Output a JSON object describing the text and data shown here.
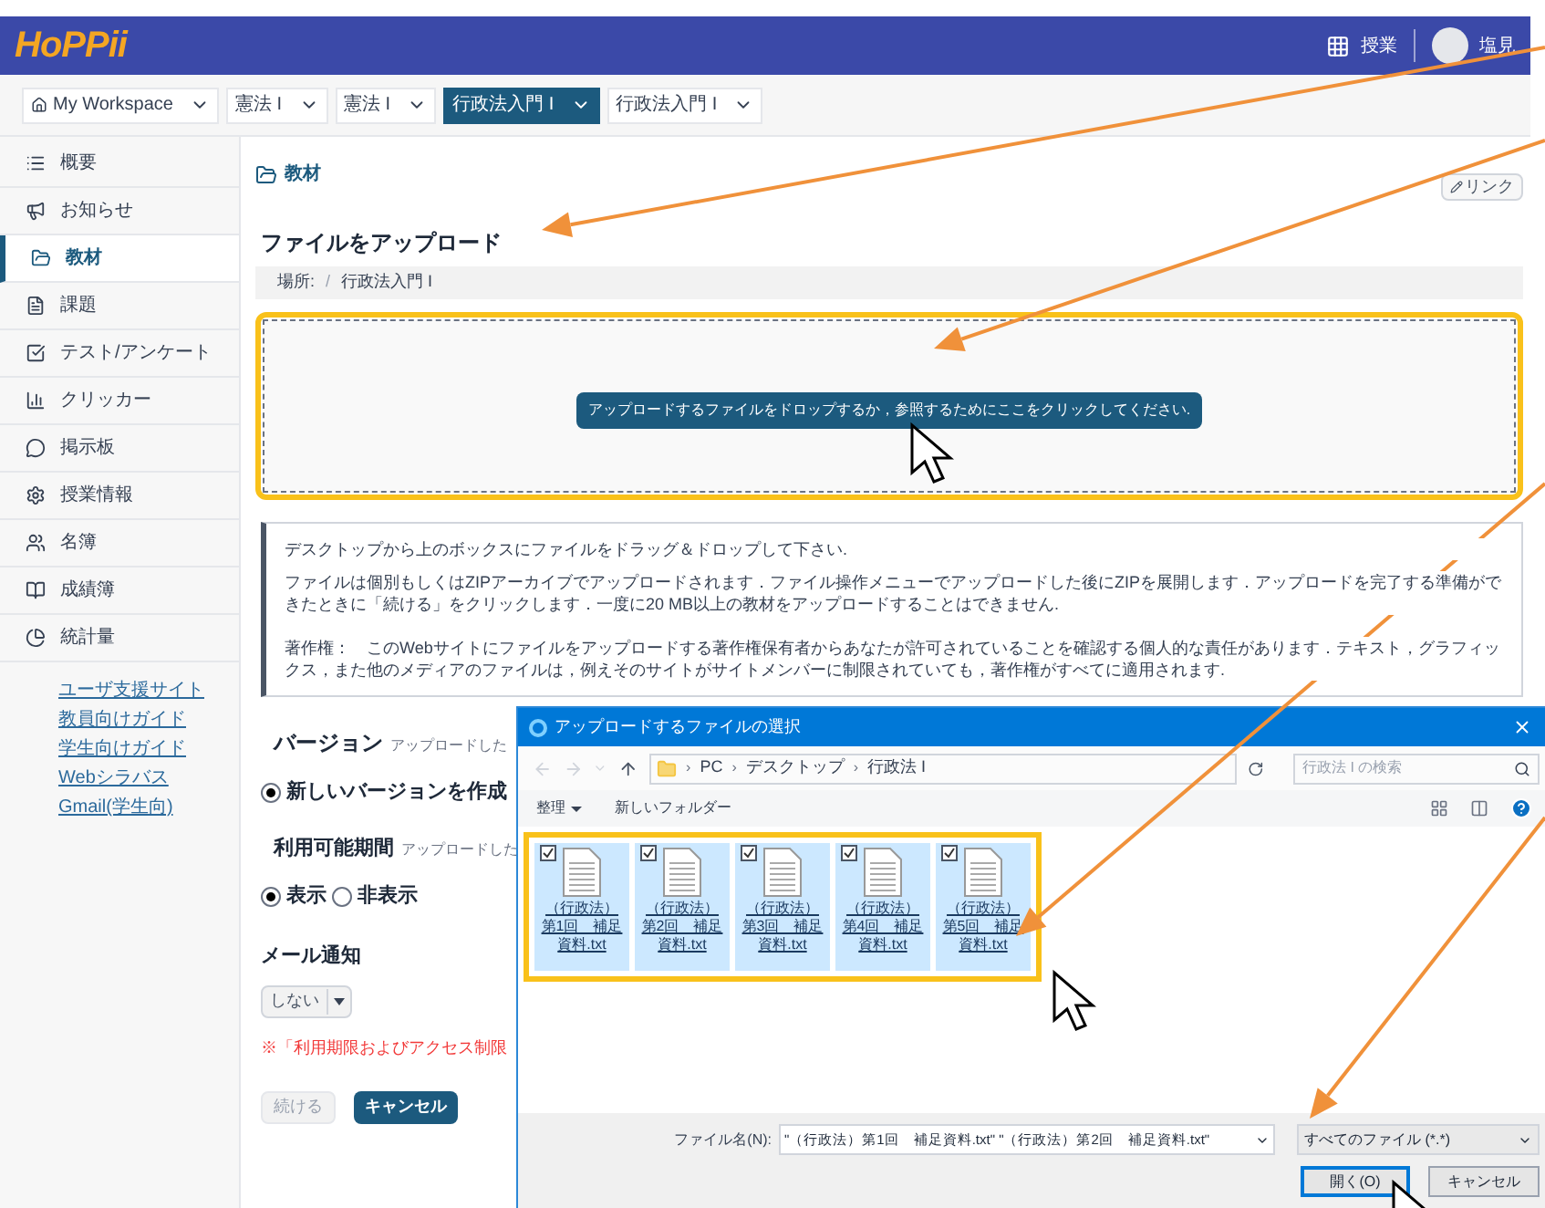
{
  "header": {
    "logo": "HoPPii",
    "apps_label": "授業",
    "user_name": "塩見"
  },
  "tabs": [
    {
      "label": "My Workspace",
      "selected": false
    },
    {
      "label": "憲法 I",
      "selected": false
    },
    {
      "label": "憲法 I",
      "selected": false
    },
    {
      "label": "行政法入門 I",
      "selected": true
    },
    {
      "label": "行政法入門 I",
      "selected": false
    }
  ],
  "sidebar": {
    "items": [
      {
        "label": "概要",
        "selected": false
      },
      {
        "label": "お知らせ",
        "selected": false
      },
      {
        "label": "教材",
        "selected": true
      },
      {
        "label": "課題",
        "selected": false
      },
      {
        "label": "テスト/アンケート",
        "selected": false
      },
      {
        "label": "クリッカー",
        "selected": false
      },
      {
        "label": "掲示板",
        "selected": false
      },
      {
        "label": "授業情報",
        "selected": false
      },
      {
        "label": "名簿",
        "selected": false
      },
      {
        "label": "成績簿",
        "selected": false
      },
      {
        "label": "統計量",
        "selected": false
      }
    ],
    "links": [
      "ユーザ支援サイト",
      "教員向けガイド",
      "学生向けガイド",
      "Webシラバス",
      "Gmail(学生向)"
    ]
  },
  "main": {
    "section_title": "教材",
    "link_button": "リンク",
    "heading": "ファイルをアップロード",
    "breadcrumb": {
      "label": "場所:",
      "separator": "/",
      "path": "行政法入門 I"
    },
    "drop_button": "アップロードするファイルをドロップするか，参照するためにここをクリックしてください.",
    "info": [
      "デスクトップから上のボックスにファイルをドラッグ＆ドロップして下さい.",
      "ファイルは個別もしくはZIPアーカイブでアップロードされます．ファイル操作メニューでアップロードした後にZIPを展開します．アップロードを完了する準備ができたときに「続ける」をクリックします．一度に20 MB以上の教材をアップロードすることはできません.",
      "著作権：　このWebサイトにファイルをアップロードする著作権保有者からあなたが許可されていることを確認する個人的な責任があります．テキスト，グラフィックス，また他のメディアのファイルは，例えそのサイトがサイトメンバーに制限されていても，著作権がすべてに適用されます."
    ],
    "version": {
      "label": "バージョン",
      "description": "アップロードした",
      "options": [
        {
          "label": "新しいバージョンを作成",
          "selected": true
        }
      ]
    },
    "availability": {
      "label": "利用可能期間",
      "description": "アップロードした",
      "options": [
        {
          "label": "表示",
          "selected": true
        },
        {
          "label": "非表示",
          "selected": false
        }
      ]
    },
    "mail": {
      "label": "メール通知",
      "value": "しない"
    },
    "note": "※「利用期限およびアクセス制限",
    "buttons": [
      {
        "label": "続ける",
        "kind": "secondary"
      },
      {
        "label": "キャンセル",
        "kind": "primary"
      }
    ]
  },
  "dialog": {
    "title": "アップロードするファイルの選択",
    "path": [
      {
        "separator": "›",
        "label": "PC"
      },
      {
        "separator": "›",
        "label": "デスクトップ"
      },
      {
        "separator": "›",
        "label": "行政法 I"
      }
    ],
    "search_placeholder": "行政法 I の検索",
    "toolbar": [
      "整理",
      "新しいフォルダー"
    ],
    "files": [
      {
        "name": "（行政法）第1回　補足資料.txt",
        "checked": true
      },
      {
        "name": "（行政法）第2回　補足資料.txt",
        "checked": true
      },
      {
        "name": "（行政法）第3回　補足資料.txt",
        "checked": true
      },
      {
        "name": "（行政法）第4回　補足資料.txt",
        "checked": true
      },
      {
        "name": "（行政法）第5回　補足資料.txt",
        "checked": true
      }
    ],
    "filename_label": "ファイル名(N):",
    "filename_value": "\"（行政法）第1回　補足資料.txt\" \"（行政法）第2回　補足資料.txt\"",
    "filetype": "すべてのファイル (*.*)",
    "open_button": "開く(O)",
    "cancel_button": "キャンセル"
  }
}
